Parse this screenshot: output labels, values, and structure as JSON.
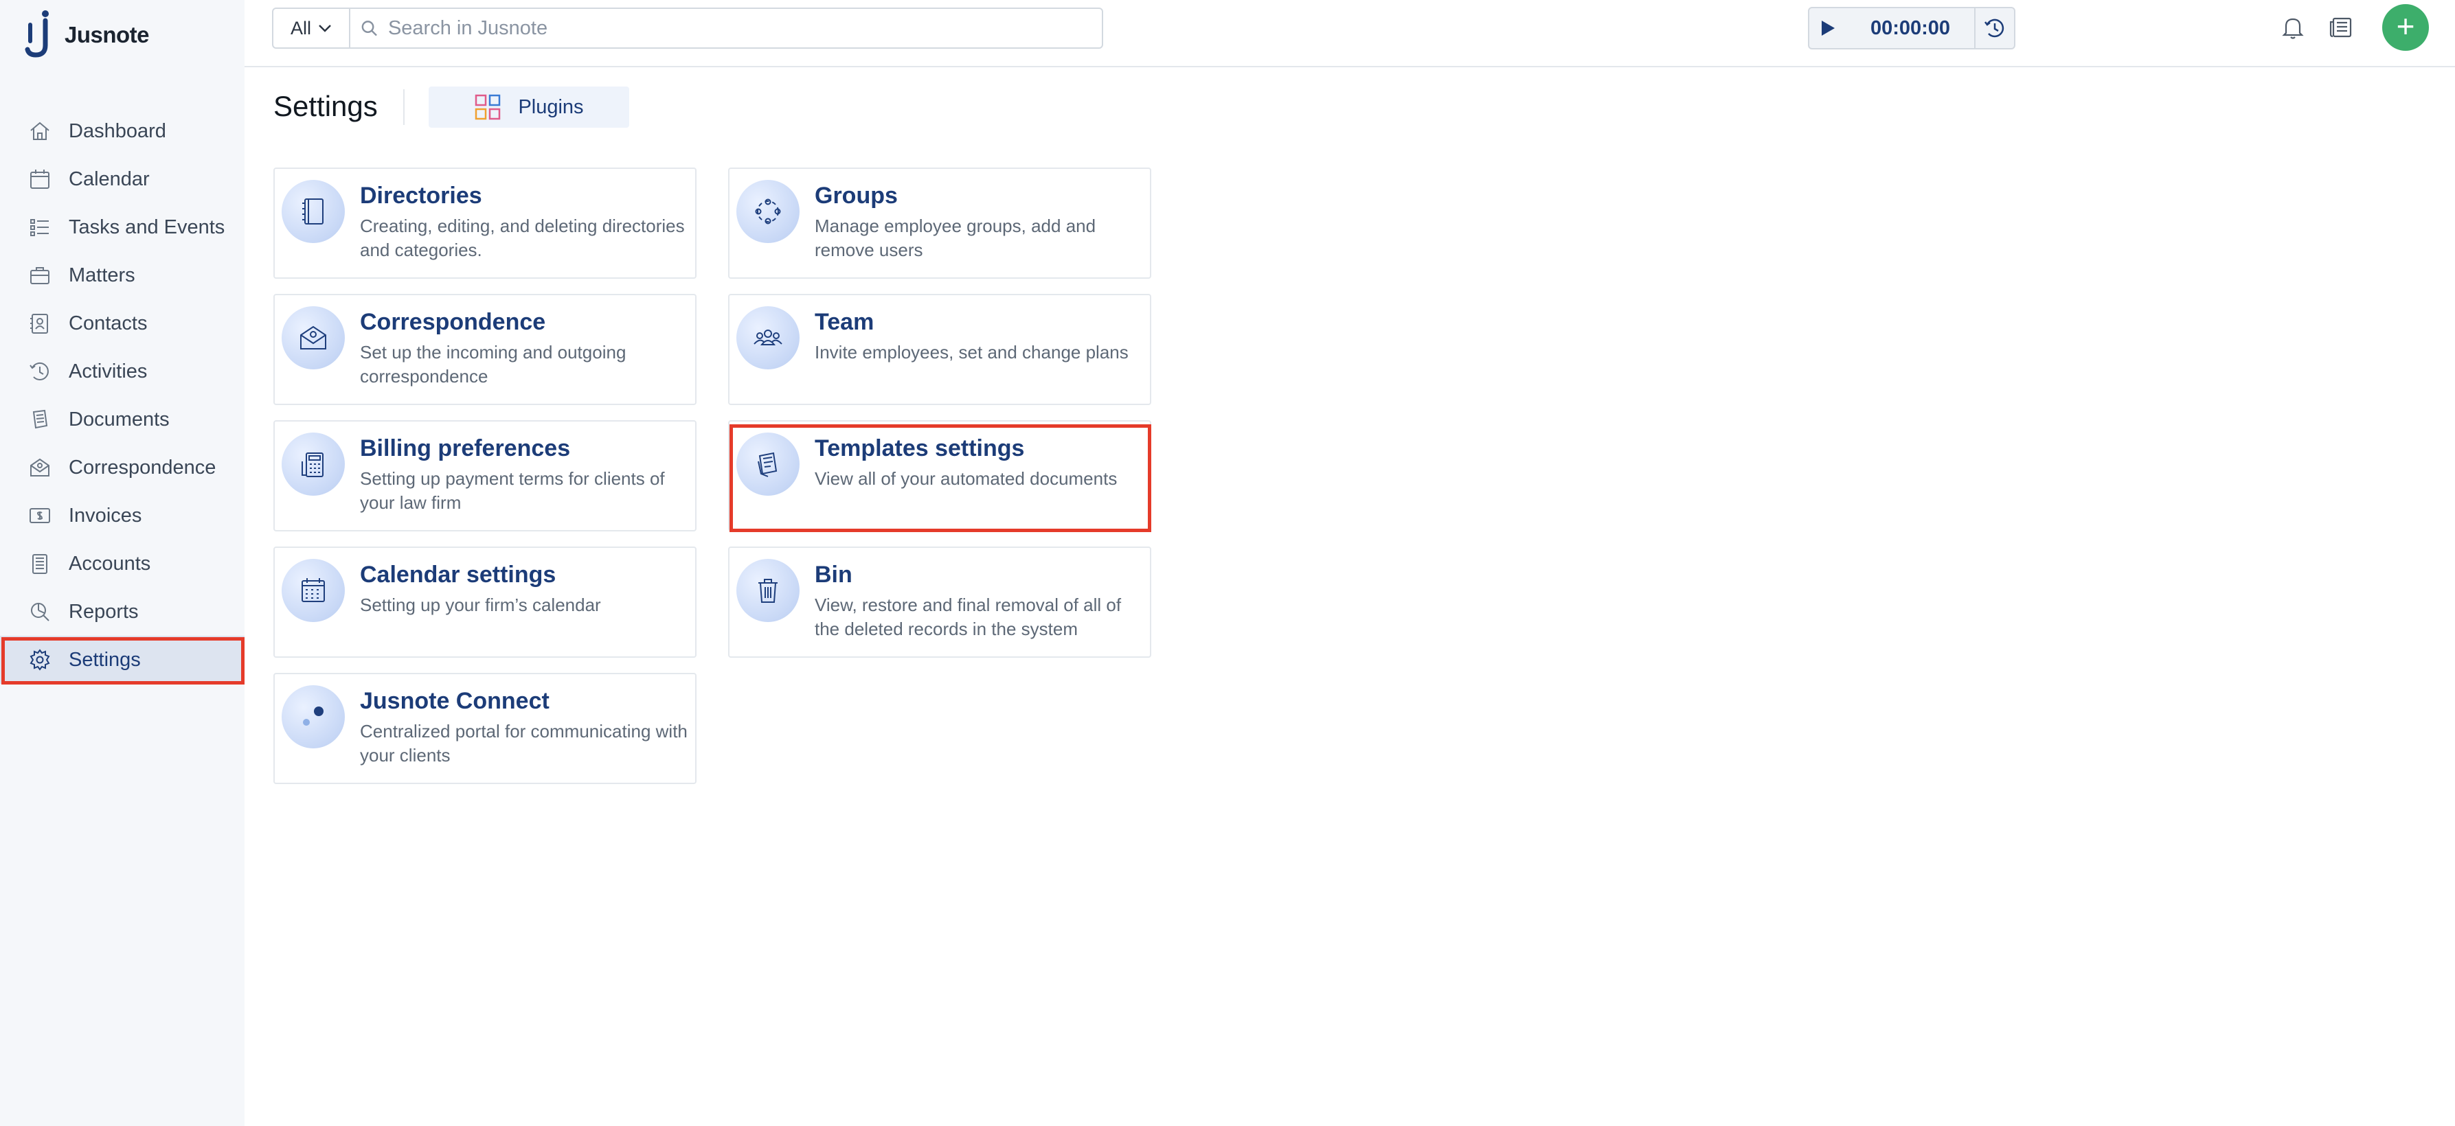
{
  "app": {
    "name": "Jusnote",
    "brand_color": "#1c3c78",
    "highlight_color": "#e53b2a",
    "add_button_color": "#3dae6b"
  },
  "sidebar": {
    "items": [
      {
        "label": "Dashboard",
        "icon": "home-icon"
      },
      {
        "label": "Calendar",
        "icon": "calendar-icon"
      },
      {
        "label": "Tasks and Events",
        "icon": "tasks-icon"
      },
      {
        "label": "Matters",
        "icon": "briefcase-icon"
      },
      {
        "label": "Contacts",
        "icon": "contacts-icon"
      },
      {
        "label": "Activities",
        "icon": "activity-clock-icon"
      },
      {
        "label": "Documents",
        "icon": "documents-icon"
      },
      {
        "label": "Correspondence",
        "icon": "mail-icon"
      },
      {
        "label": "Invoices",
        "icon": "invoice-icon"
      },
      {
        "label": "Accounts",
        "icon": "accounts-icon"
      },
      {
        "label": "Reports",
        "icon": "reports-icon"
      },
      {
        "label": "Settings",
        "icon": "gear-icon",
        "active": true
      }
    ]
  },
  "topbar": {
    "search_scope": "All",
    "search_placeholder": "Search in Jusnote",
    "timer_value": "00:00:00",
    "add_label": "+"
  },
  "header": {
    "title": "Settings",
    "plugins_label": "Plugins"
  },
  "cards": [
    {
      "title": "Directories",
      "description": "Creating, editing, and deleting directories and categories.",
      "icon": "directory-book-icon"
    },
    {
      "title": "Groups",
      "description": "Manage employee groups, add and remove users",
      "icon": "groups-icon"
    },
    {
      "title": "Correspondence",
      "description": "Set up the incoming and outgoing correspondence",
      "icon": "envelope-icon"
    },
    {
      "title": "Team",
      "description": "Invite employees, set and change plans",
      "icon": "team-icon"
    },
    {
      "title": "Billing preferences",
      "description": "Setting up payment terms for clients of your law firm",
      "icon": "billing-icon"
    },
    {
      "title": "Templates settings",
      "description": "View all of your automated documents",
      "icon": "templates-icon",
      "highlighted": true
    },
    {
      "title": "Calendar settings",
      "description": "Setting up your firm’s calendar",
      "icon": "calendar-settings-icon"
    },
    {
      "title": "Bin",
      "description": "View, restore and final removal of all of the deleted records in the system",
      "icon": "trash-icon"
    },
    {
      "title": "Jusnote Connect",
      "description": "Centralized portal for communicating with your clients",
      "icon": "connect-icon"
    }
  ]
}
